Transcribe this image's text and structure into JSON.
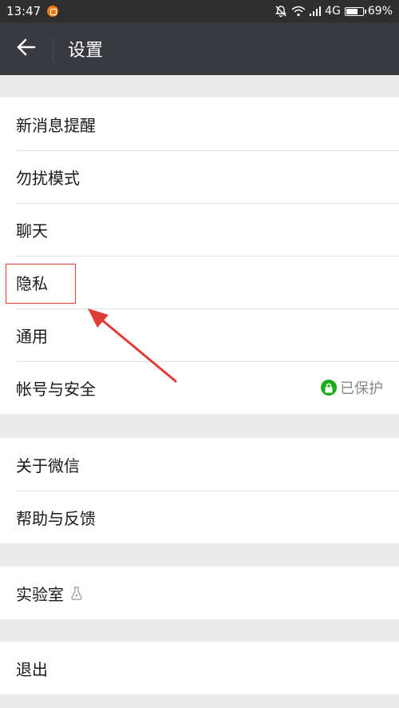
{
  "status_bar": {
    "time": "13:47",
    "network": "4G",
    "battery": "69%"
  },
  "header": {
    "title": "设置"
  },
  "groups": [
    {
      "items": [
        {
          "label": "新消息提醒"
        },
        {
          "label": "勿扰模式"
        },
        {
          "label": "聊天"
        },
        {
          "label": "隐私"
        },
        {
          "label": "通用"
        },
        {
          "label": "帐号与安全",
          "value": "已保护"
        }
      ]
    },
    {
      "items": [
        {
          "label": "关于微信"
        },
        {
          "label": "帮助与反馈"
        }
      ]
    },
    {
      "items": [
        {
          "label": "实验室"
        }
      ]
    },
    {
      "items": [
        {
          "label": "退出"
        }
      ]
    }
  ],
  "colors": {
    "header_bg": "#393a3f",
    "status_bg": "#2e2e2e",
    "page_bg": "#ebebeb",
    "secure_green": "#1aad19",
    "annotation_red": "#e03b35"
  },
  "icons": {
    "back": "arrow-left-icon",
    "secure": "lock-icon",
    "lab": "flask-icon",
    "notification_muted": "bell-off-icon",
    "wifi": "wifi-icon",
    "signal": "signal-icon",
    "battery": "battery-icon"
  }
}
